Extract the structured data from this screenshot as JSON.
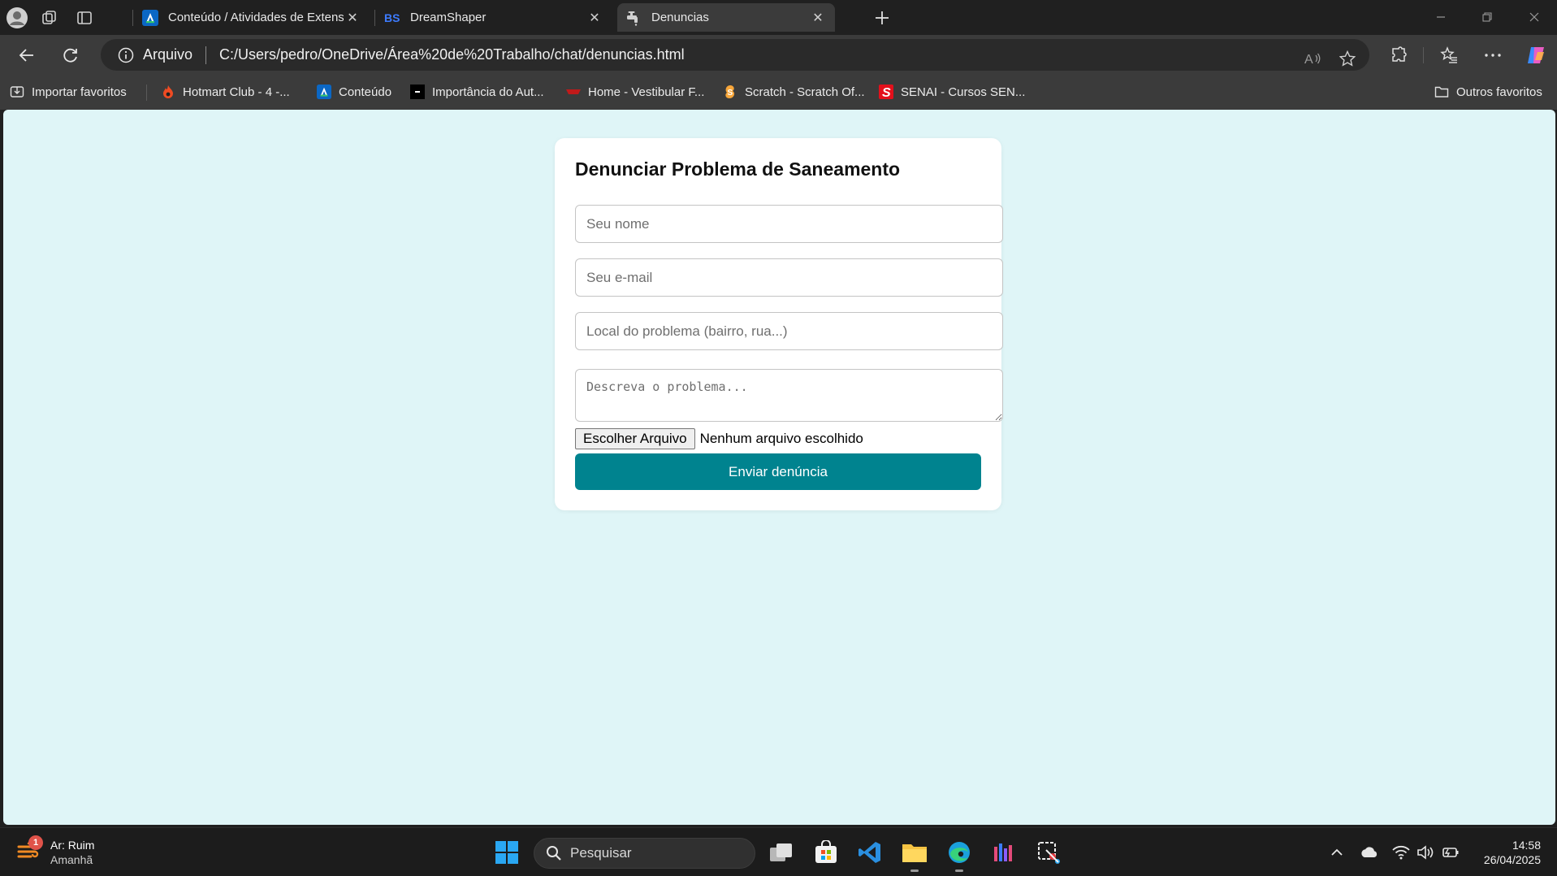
{
  "browser": {
    "tabs": [
      {
        "title": "Conteúdo / Atividades de Extensã",
        "favicon": "a-logo-icon",
        "active": false
      },
      {
        "title": "DreamShaper",
        "favicon": "bs-logo-icon",
        "active": false
      },
      {
        "title": "Denuncias",
        "favicon": "faucet-icon",
        "active": true
      }
    ],
    "address": {
      "scheme_label": "Arquivo",
      "url": "C:/Users/pedro/OneDrive/Área%20de%20Trabalho/chat/denuncias.html"
    },
    "favorites": [
      {
        "label": "Importar favoritos",
        "icon": "import-icon"
      },
      {
        "label": "Hotmart Club - 4 -...",
        "icon": "flame-icon"
      },
      {
        "label": "Conteúdo",
        "icon": "a-logo-icon"
      },
      {
        "label": "Importância do Aut...",
        "icon": "black-square-icon"
      },
      {
        "label": "Home - Vestibular F...",
        "icon": "red-logo-icon"
      },
      {
        "label": "Scratch - Scratch Of...",
        "icon": "scratch-icon"
      },
      {
        "label": "SENAI - Cursos SEN...",
        "icon": "senai-s-icon"
      }
    ],
    "other_favorites": "Outros favoritos"
  },
  "page": {
    "title": "Denunciar Problema de Saneamento",
    "fields": {
      "name_placeholder": "Seu nome",
      "email_placeholder": "Seu e-mail",
      "location_placeholder": "Local do problema (bairro, rua...)",
      "description_placeholder": "Descreva o problema..."
    },
    "file": {
      "button_label": "Escolher Arquivo",
      "status": "Nenhum arquivo escolhido"
    },
    "submit_label": "Enviar denúncia"
  },
  "taskbar": {
    "weather": {
      "badge": "1",
      "title": "Ar: Ruim",
      "subtitle": "Amanhã"
    },
    "search_label": "Pesquisar",
    "apps": [
      "windows-start-icon",
      "task-view-icon",
      "store-icon",
      "vscode-icon",
      "file-explorer-icon",
      "edge-icon",
      "app-icon",
      "snipping-tool-icon"
    ],
    "clock": {
      "time": "14:58",
      "date": "26/04/2025"
    }
  },
  "colors": {
    "page_background": "#dff5f7",
    "accent": "#00838f",
    "card": "#ffffff",
    "chrome_dark": "#202020",
    "chrome_mid": "#3b3b3b"
  }
}
